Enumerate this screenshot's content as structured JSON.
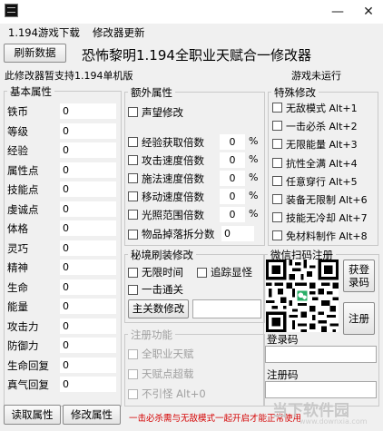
{
  "window": {
    "close_glyph": "✕"
  },
  "menu": [
    "1.194游戏下载",
    "修改器更新"
  ],
  "header": {
    "refresh_button": "刷新数据",
    "title": "恐怖黎明1.194全职业天赋合一修改器",
    "support_note": "此修改器暂支持1.194单机版",
    "game_status": "游戏未运行"
  },
  "basic": {
    "title": "基本属性",
    "rows": [
      {
        "label": "铁币",
        "value": "0"
      },
      {
        "label": "等级",
        "value": "0"
      },
      {
        "label": "经验",
        "value": "0"
      },
      {
        "label": "属性点",
        "value": "0"
      },
      {
        "label": "技能点",
        "value": "0"
      },
      {
        "label": "虔诚点",
        "value": "0"
      },
      {
        "label": "体格",
        "value": "0"
      },
      {
        "label": "灵巧",
        "value": "0"
      },
      {
        "label": "精神",
        "value": "0"
      },
      {
        "label": "生命",
        "value": "0"
      },
      {
        "label": "能量",
        "value": "0"
      },
      {
        "label": "攻击力",
        "value": "0"
      },
      {
        "label": "防御力",
        "value": "0"
      },
      {
        "label": "生命回复",
        "value": "0"
      },
      {
        "label": "真气回复",
        "value": "0"
      }
    ],
    "read_button": "读取属性",
    "modify_button": "修改属性"
  },
  "extra": {
    "title": "额外属性",
    "reputation": "声望修改",
    "multipliers": [
      {
        "label": "经验获取倍数",
        "value": "0",
        "unit": "%"
      },
      {
        "label": "攻击速度倍数",
        "value": "0",
        "unit": "%"
      },
      {
        "label": "施法速度倍数",
        "value": "0",
        "unit": "%"
      },
      {
        "label": "移动速度倍数",
        "value": "0",
        "unit": "%"
      },
      {
        "label": "光照范围倍数",
        "value": "0",
        "unit": "%"
      }
    ],
    "drop": {
      "label": "物品掉落拆分数",
      "value": "0"
    }
  },
  "special": {
    "title": "特殊修改",
    "items": [
      "无敌模式 Alt+1",
      "一击必杀 Alt+2",
      "无限能量 Alt+3",
      "抗性全满 Alt+4",
      "任意穿行 Alt+5",
      "装备无限制 Alt+6",
      "技能无冷却 Alt+7",
      "免材料制作 Alt+8"
    ]
  },
  "dungeon": {
    "title": "秘境刷装修改",
    "unlimited_time": "无限时间",
    "trace_display": "追踪显怪",
    "one_hit_clear": "一击通关",
    "boss_button": "主关数修改"
  },
  "register": {
    "title": "注册功能",
    "items": [
      "全职业天赋",
      "天赋点超载",
      "不引怪 Alt+0"
    ]
  },
  "wechat": {
    "title": "微信扫码注册",
    "get_code_button": "获登录码",
    "register_button": "注册",
    "login_code_label": "登录码",
    "reg_code_label": "注册码"
  },
  "footer": {
    "note": "一击必杀需与无敌模式一起开启才能正常使用",
    "watermark": "当下软件园",
    "watermark_url": "www.downxia.com"
  }
}
